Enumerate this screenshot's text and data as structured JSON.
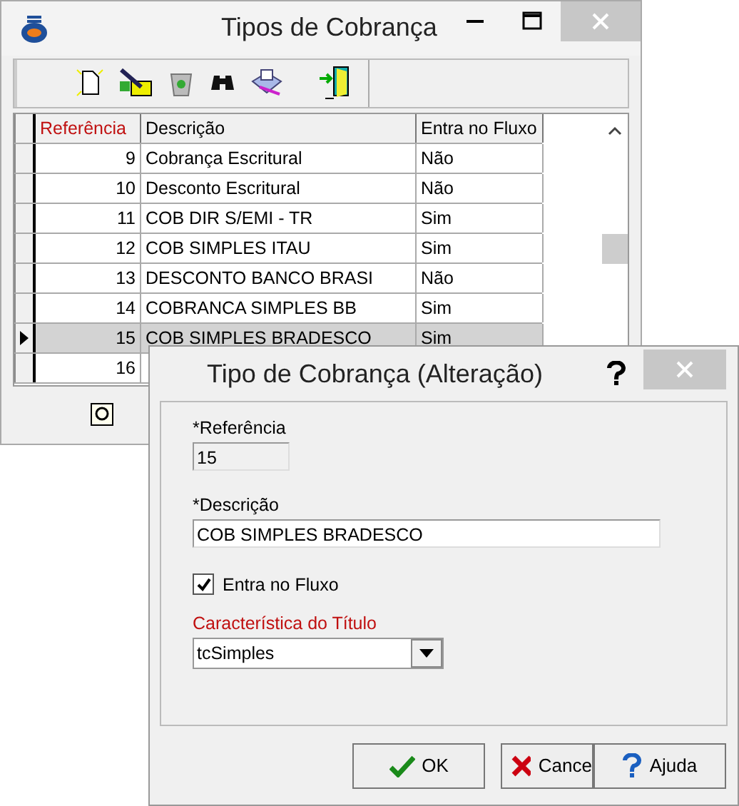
{
  "main_window": {
    "title": "Tipos de Cobrança",
    "table": {
      "columns": [
        {
          "label": "Referência",
          "sorted": true
        },
        {
          "label": "Descrição",
          "sorted": false
        },
        {
          "label": "Entra no Fluxo",
          "sorted": false
        }
      ],
      "rows": [
        {
          "cells": [
            "9",
            "Cobrança Escritural",
            "Não"
          ],
          "selected": false
        },
        {
          "cells": [
            "10",
            "Desconto Escritural",
            "Não"
          ],
          "selected": false
        },
        {
          "cells": [
            "11",
            "COB DIR S/EMI - TR",
            "Sim"
          ],
          "selected": false
        },
        {
          "cells": [
            "12",
            "COB SIMPLES ITAU",
            "Sim"
          ],
          "selected": false
        },
        {
          "cells": [
            "13",
            "DESCONTO BANCO BRASI",
            "Não"
          ],
          "selected": false
        },
        {
          "cells": [
            "14",
            "COBRANCA SIMPLES BB",
            "Sim"
          ],
          "selected": false
        },
        {
          "cells": [
            "15",
            "COB SIMPLES BRADESCO",
            "Sim"
          ],
          "selected": true
        },
        {
          "cells": [
            "16"
          ],
          "selected": false
        }
      ]
    }
  },
  "dialog": {
    "title": "Tipo de Cobrança (Alteração)",
    "fields": [
      {
        "label": "*Referência",
        "value": "15",
        "kind": "short"
      },
      {
        "label": "*Descrição",
        "value": "COB SIMPLES BRADESCO",
        "kind": "long"
      }
    ],
    "checkbox": {
      "label": "Entra no Fluxo",
      "checked": true
    },
    "select": {
      "label": "Característica do Título",
      "value": "tcSimples",
      "highlighted": true
    },
    "buttons": [
      {
        "label": "OK",
        "kind": "ok"
      },
      {
        "label": "Cance",
        "kind": "cancel"
      },
      {
        "label": "Ajuda",
        "kind": "help"
      }
    ]
  }
}
